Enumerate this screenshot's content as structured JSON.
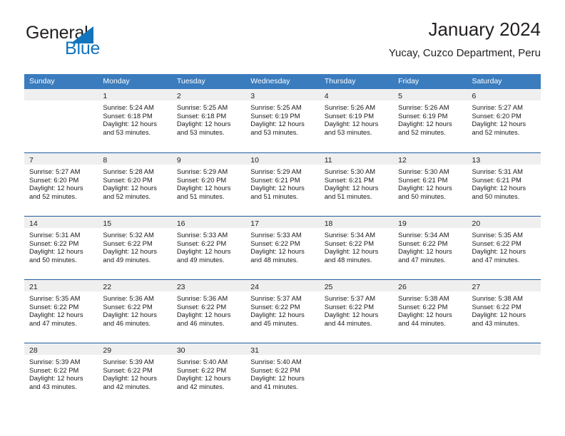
{
  "brand": {
    "name_part1": "General",
    "name_part2": "Blue",
    "triangle_color": "#1274bc"
  },
  "header": {
    "title": "January 2024",
    "subtitle": "Yucay, Cuzco Department, Peru"
  },
  "theme": {
    "weekday_header_bg": "#3a7cbe",
    "weekday_header_text": "#ffffff",
    "week_separator": "#1f5c9e",
    "daynum_band_bg": "#efeff0"
  },
  "weekdays": [
    "Sunday",
    "Monday",
    "Tuesday",
    "Wednesday",
    "Thursday",
    "Friday",
    "Saturday"
  ],
  "weeks": [
    [
      {
        "day": "",
        "sunrise": "",
        "sunset": "",
        "daylight_line1": "",
        "daylight_line2": "",
        "empty": true
      },
      {
        "day": "1",
        "sunrise": "Sunrise: 5:24 AM",
        "sunset": "Sunset: 6:18 PM",
        "daylight_line1": "Daylight: 12 hours",
        "daylight_line2": "and 53 minutes."
      },
      {
        "day": "2",
        "sunrise": "Sunrise: 5:25 AM",
        "sunset": "Sunset: 6:18 PM",
        "daylight_line1": "Daylight: 12 hours",
        "daylight_line2": "and 53 minutes."
      },
      {
        "day": "3",
        "sunrise": "Sunrise: 5:25 AM",
        "sunset": "Sunset: 6:19 PM",
        "daylight_line1": "Daylight: 12 hours",
        "daylight_line2": "and 53 minutes."
      },
      {
        "day": "4",
        "sunrise": "Sunrise: 5:26 AM",
        "sunset": "Sunset: 6:19 PM",
        "daylight_line1": "Daylight: 12 hours",
        "daylight_line2": "and 53 minutes."
      },
      {
        "day": "5",
        "sunrise": "Sunrise: 5:26 AM",
        "sunset": "Sunset: 6:19 PM",
        "daylight_line1": "Daylight: 12 hours",
        "daylight_line2": "and 52 minutes."
      },
      {
        "day": "6",
        "sunrise": "Sunrise: 5:27 AM",
        "sunset": "Sunset: 6:20 PM",
        "daylight_line1": "Daylight: 12 hours",
        "daylight_line2": "and 52 minutes."
      }
    ],
    [
      {
        "day": "7",
        "sunrise": "Sunrise: 5:27 AM",
        "sunset": "Sunset: 6:20 PM",
        "daylight_line1": "Daylight: 12 hours",
        "daylight_line2": "and 52 minutes."
      },
      {
        "day": "8",
        "sunrise": "Sunrise: 5:28 AM",
        "sunset": "Sunset: 6:20 PM",
        "daylight_line1": "Daylight: 12 hours",
        "daylight_line2": "and 52 minutes."
      },
      {
        "day": "9",
        "sunrise": "Sunrise: 5:29 AM",
        "sunset": "Sunset: 6:20 PM",
        "daylight_line1": "Daylight: 12 hours",
        "daylight_line2": "and 51 minutes."
      },
      {
        "day": "10",
        "sunrise": "Sunrise: 5:29 AM",
        "sunset": "Sunset: 6:21 PM",
        "daylight_line1": "Daylight: 12 hours",
        "daylight_line2": "and 51 minutes."
      },
      {
        "day": "11",
        "sunrise": "Sunrise: 5:30 AM",
        "sunset": "Sunset: 6:21 PM",
        "daylight_line1": "Daylight: 12 hours",
        "daylight_line2": "and 51 minutes."
      },
      {
        "day": "12",
        "sunrise": "Sunrise: 5:30 AM",
        "sunset": "Sunset: 6:21 PM",
        "daylight_line1": "Daylight: 12 hours",
        "daylight_line2": "and 50 minutes."
      },
      {
        "day": "13",
        "sunrise": "Sunrise: 5:31 AM",
        "sunset": "Sunset: 6:21 PM",
        "daylight_line1": "Daylight: 12 hours",
        "daylight_line2": "and 50 minutes."
      }
    ],
    [
      {
        "day": "14",
        "sunrise": "Sunrise: 5:31 AM",
        "sunset": "Sunset: 6:22 PM",
        "daylight_line1": "Daylight: 12 hours",
        "daylight_line2": "and 50 minutes."
      },
      {
        "day": "15",
        "sunrise": "Sunrise: 5:32 AM",
        "sunset": "Sunset: 6:22 PM",
        "daylight_line1": "Daylight: 12 hours",
        "daylight_line2": "and 49 minutes."
      },
      {
        "day": "16",
        "sunrise": "Sunrise: 5:33 AM",
        "sunset": "Sunset: 6:22 PM",
        "daylight_line1": "Daylight: 12 hours",
        "daylight_line2": "and 49 minutes."
      },
      {
        "day": "17",
        "sunrise": "Sunrise: 5:33 AM",
        "sunset": "Sunset: 6:22 PM",
        "daylight_line1": "Daylight: 12 hours",
        "daylight_line2": "and 48 minutes."
      },
      {
        "day": "18",
        "sunrise": "Sunrise: 5:34 AM",
        "sunset": "Sunset: 6:22 PM",
        "daylight_line1": "Daylight: 12 hours",
        "daylight_line2": "and 48 minutes."
      },
      {
        "day": "19",
        "sunrise": "Sunrise: 5:34 AM",
        "sunset": "Sunset: 6:22 PM",
        "daylight_line1": "Daylight: 12 hours",
        "daylight_line2": "and 47 minutes."
      },
      {
        "day": "20",
        "sunrise": "Sunrise: 5:35 AM",
        "sunset": "Sunset: 6:22 PM",
        "daylight_line1": "Daylight: 12 hours",
        "daylight_line2": "and 47 minutes."
      }
    ],
    [
      {
        "day": "21",
        "sunrise": "Sunrise: 5:35 AM",
        "sunset": "Sunset: 6:22 PM",
        "daylight_line1": "Daylight: 12 hours",
        "daylight_line2": "and 47 minutes."
      },
      {
        "day": "22",
        "sunrise": "Sunrise: 5:36 AM",
        "sunset": "Sunset: 6:22 PM",
        "daylight_line1": "Daylight: 12 hours",
        "daylight_line2": "and 46 minutes."
      },
      {
        "day": "23",
        "sunrise": "Sunrise: 5:36 AM",
        "sunset": "Sunset: 6:22 PM",
        "daylight_line1": "Daylight: 12 hours",
        "daylight_line2": "and 46 minutes."
      },
      {
        "day": "24",
        "sunrise": "Sunrise: 5:37 AM",
        "sunset": "Sunset: 6:22 PM",
        "daylight_line1": "Daylight: 12 hours",
        "daylight_line2": "and 45 minutes."
      },
      {
        "day": "25",
        "sunrise": "Sunrise: 5:37 AM",
        "sunset": "Sunset: 6:22 PM",
        "daylight_line1": "Daylight: 12 hours",
        "daylight_line2": "and 44 minutes."
      },
      {
        "day": "26",
        "sunrise": "Sunrise: 5:38 AM",
        "sunset": "Sunset: 6:22 PM",
        "daylight_line1": "Daylight: 12 hours",
        "daylight_line2": "and 44 minutes."
      },
      {
        "day": "27",
        "sunrise": "Sunrise: 5:38 AM",
        "sunset": "Sunset: 6:22 PM",
        "daylight_line1": "Daylight: 12 hours",
        "daylight_line2": "and 43 minutes."
      }
    ],
    [
      {
        "day": "28",
        "sunrise": "Sunrise: 5:39 AM",
        "sunset": "Sunset: 6:22 PM",
        "daylight_line1": "Daylight: 12 hours",
        "daylight_line2": "and 43 minutes."
      },
      {
        "day": "29",
        "sunrise": "Sunrise: 5:39 AM",
        "sunset": "Sunset: 6:22 PM",
        "daylight_line1": "Daylight: 12 hours",
        "daylight_line2": "and 42 minutes."
      },
      {
        "day": "30",
        "sunrise": "Sunrise: 5:40 AM",
        "sunset": "Sunset: 6:22 PM",
        "daylight_line1": "Daylight: 12 hours",
        "daylight_line2": "and 42 minutes."
      },
      {
        "day": "31",
        "sunrise": "Sunrise: 5:40 AM",
        "sunset": "Sunset: 6:22 PM",
        "daylight_line1": "Daylight: 12 hours",
        "daylight_line2": "and 41 minutes."
      },
      {
        "day": "",
        "sunrise": "",
        "sunset": "",
        "daylight_line1": "",
        "daylight_line2": "",
        "empty": true
      },
      {
        "day": "",
        "sunrise": "",
        "sunset": "",
        "daylight_line1": "",
        "daylight_line2": "",
        "empty": true
      },
      {
        "day": "",
        "sunrise": "",
        "sunset": "",
        "daylight_line1": "",
        "daylight_line2": "",
        "empty": true
      }
    ]
  ]
}
